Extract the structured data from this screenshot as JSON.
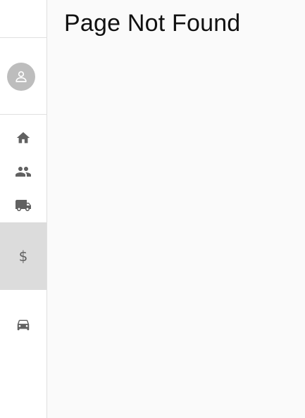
{
  "page": {
    "title": "Page Not Found"
  },
  "sidebar": {
    "avatar_icon": "person-icon",
    "items": [
      {
        "icon": "home-icon"
      },
      {
        "icon": "people-icon"
      },
      {
        "icon": "truck-icon"
      },
      {
        "icon": "dollar-icon",
        "label": "$",
        "active": true
      },
      {
        "icon": "car-icon"
      }
    ]
  },
  "colors": {
    "icon": "#616161",
    "active_background": "#dcdcdc",
    "avatar_background": "#bdbdbd",
    "content_background": "#fafafa",
    "sidebar_background": "#ffffff",
    "divider": "#e0e0e0"
  }
}
